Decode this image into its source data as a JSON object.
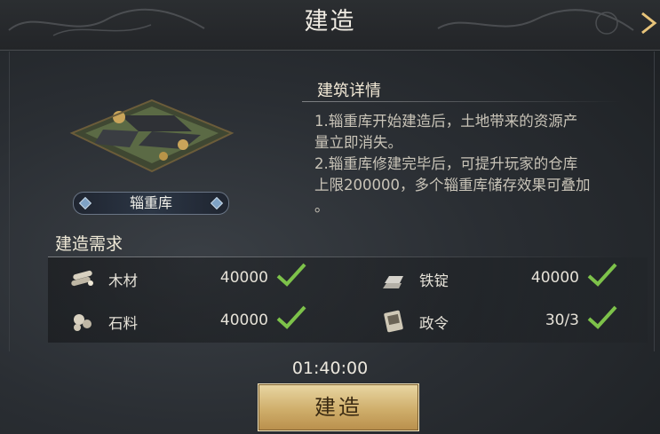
{
  "header": {
    "title": "建造"
  },
  "building": {
    "name": "辎重库"
  },
  "details": {
    "title": "建筑详情",
    "lines": [
      "1.辎重库开始建造后，土地带来的资源产",
      "量立即消失。",
      "2.辎重库修建完毕后，可提升玩家的仓库",
      "上限200000，多个辎重库储存效果可叠加",
      "。"
    ]
  },
  "requirements": {
    "title": "建造需求",
    "items": [
      {
        "icon": "wood-icon",
        "label": "木材",
        "value": "40000",
        "met": true
      },
      {
        "icon": "iron-ingot-icon",
        "label": "铁锭",
        "value": "40000",
        "met": true
      },
      {
        "icon": "stone-icon",
        "label": "石料",
        "value": "40000",
        "met": true
      },
      {
        "icon": "decree-icon",
        "label": "政令",
        "value": "30/3",
        "met": true
      }
    ]
  },
  "timer": "01:40:00",
  "build_button": "建造",
  "colors": {
    "check": "#7dc24a",
    "button_gold": "#d4b272"
  }
}
